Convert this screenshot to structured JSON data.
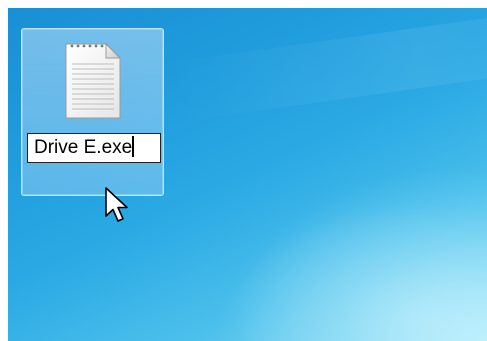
{
  "desktop": {
    "selected_item": {
      "icon": "text-document-icon",
      "rename_value": "Drive E.exe"
    }
  },
  "pointer": {
    "icon": "arrow-cursor-icon"
  }
}
